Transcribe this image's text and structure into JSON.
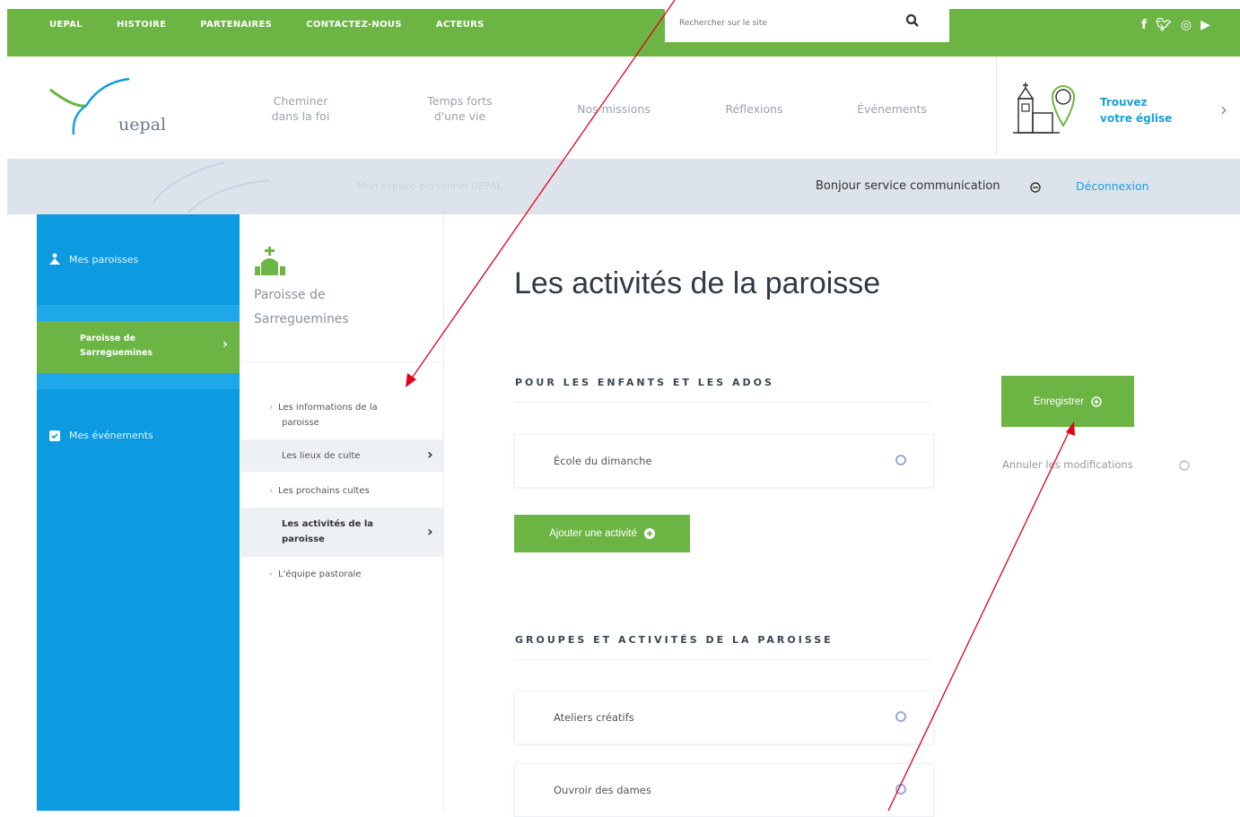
{
  "topbar": {
    "nav": [
      "UEPAL",
      "HISTOIRE",
      "PARTENAIRES",
      "CONTACTEZ-NOUS",
      "ACTEURS"
    ],
    "search_placeholder": "Rechercher sur le site",
    "social_icons": [
      "facebook-icon",
      "twitter-icon",
      "instagram-icon",
      "youtube-icon"
    ]
  },
  "header": {
    "logo_text": "uepal",
    "nav": [
      {
        "line1": "Cheminer",
        "line2": "dans la foi"
      },
      {
        "line1": "Temps forts",
        "line2": "d'une vie"
      },
      {
        "line1": "Nos missions",
        "line2": ""
      },
      {
        "line1": "Réflexions",
        "line2": ""
      },
      {
        "line1": "Événements",
        "line2": ""
      }
    ],
    "trouvez_line1": "Trouvez",
    "trouvez_line2": "votre église",
    "more_chevron": "›"
  },
  "userbar": {
    "espace": "Mon espace personnel UEPAL",
    "greeting": "Bonjour service communication",
    "logout": "Déconnexion"
  },
  "sidebar": {
    "paroisses_label": "Mes paroisses",
    "active_line1": "Paroisse de",
    "active_line2": "Sarreguemines",
    "events_label": "Mes événements"
  },
  "subnav": {
    "title_line1": "Paroisse de",
    "title_line2": "Sarreguemines",
    "items": [
      {
        "line1": "Les informations de la",
        "line2": "paroisse"
      },
      {
        "line1": "Les lieux de culte",
        "line2": ""
      },
      {
        "line1": "Les prochains cultes",
        "line2": ""
      },
      {
        "line1": "Les activités de la",
        "line2": "paroisse"
      },
      {
        "line1": "L'équipe pastorale",
        "line2": ""
      }
    ]
  },
  "main": {
    "title": "Les activités de la paroisse",
    "section1_title": "POUR LES ENFANTS ET LES ADOS",
    "section1_items": [
      "École du dimanche"
    ],
    "add_button": "Ajouter une activité",
    "section2_title": "GROUPES ET ACTIVITÉS DE LA PAROISSE",
    "section2_items": [
      "Ateliers créatifs",
      "Ouvroir des dames"
    ],
    "save_button": "Enregistrer",
    "cancel_link": "Annuler les modifications"
  },
  "colors": {
    "green": "#6cb544",
    "blue": "#0c9be0",
    "link_blue": "#1aa0de",
    "annotation_red": "#e0001a"
  }
}
